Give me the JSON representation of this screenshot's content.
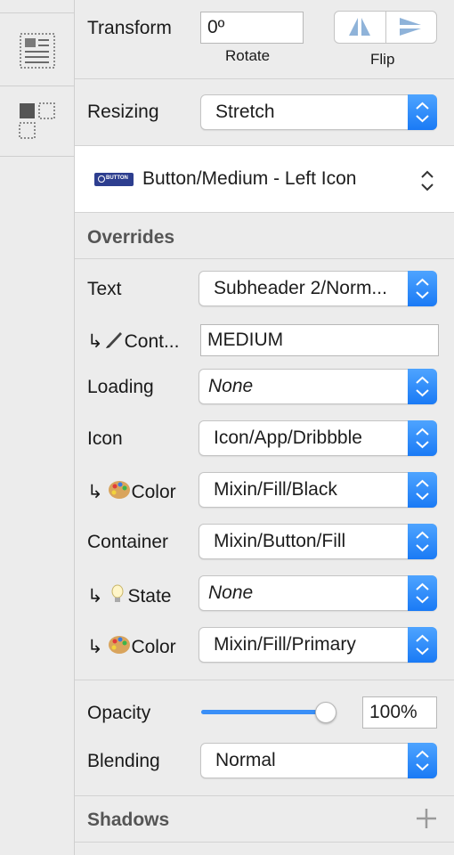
{
  "transform": {
    "label": "Transform",
    "rotate_value": "0º",
    "rotate_label": "Rotate",
    "flip_label": "Flip"
  },
  "resizing": {
    "label": "Resizing",
    "value": "Stretch"
  },
  "symbol": {
    "badge_text": "BUTTON",
    "name": "Button/Medium - Left Icon"
  },
  "overrides": {
    "title": "Overrides",
    "text": {
      "label": "Text",
      "value": "Subheader 2/Norm..."
    },
    "content": {
      "label": "Cont...",
      "value": "MEDIUM"
    },
    "loading": {
      "label": "Loading",
      "value": "None"
    },
    "icon": {
      "label": "Icon",
      "value": "Icon/App/Dribbble"
    },
    "icon_color": {
      "label": "Color",
      "value": "Mixin/Fill/Black"
    },
    "container": {
      "label": "Container",
      "value": "Mixin/Button/Fill"
    },
    "state": {
      "label": "State",
      "value": "None"
    },
    "container_color": {
      "label": "Color",
      "value": "Mixin/Fill/Primary"
    }
  },
  "opacity": {
    "label": "Opacity",
    "value": "100%",
    "level": 1.0
  },
  "blending": {
    "label": "Blending",
    "value": "Normal"
  },
  "shadows": {
    "title": "Shadows"
  },
  "colors": {
    "accent": "#1a7af5",
    "panel": "#ececec"
  }
}
